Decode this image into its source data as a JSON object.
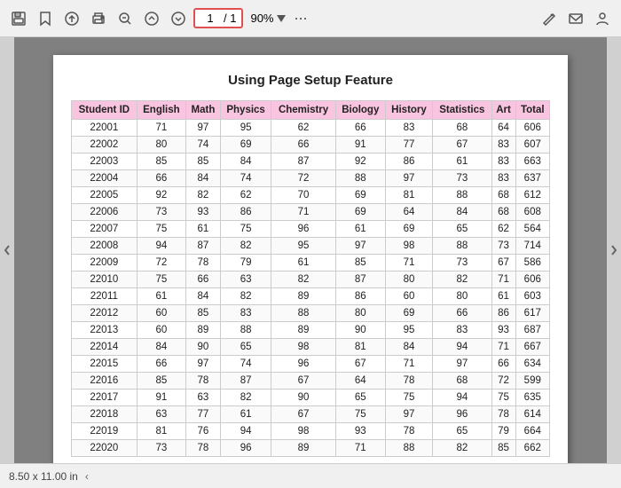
{
  "toolbar": {
    "page_current": "1",
    "page_total": "1",
    "zoom": "90%",
    "icons": [
      "save",
      "bookmark",
      "upload",
      "print",
      "zoom-out",
      "upload-arrow",
      "download-arrow"
    ],
    "more_label": "···"
  },
  "page": {
    "title": "Using Page Setup Feature",
    "columns": [
      "Student ID",
      "English",
      "Math",
      "Physics",
      "Chemistry",
      "Biology",
      "History",
      "Statistics",
      "Art",
      "Total"
    ],
    "rows": [
      [
        22001,
        71,
        97,
        95,
        62,
        66,
        83,
        68,
        64,
        606
      ],
      [
        22002,
        80,
        74,
        69,
        66,
        91,
        77,
        67,
        83,
        607
      ],
      [
        22003,
        85,
        85,
        84,
        87,
        92,
        86,
        61,
        83,
        663
      ],
      [
        22004,
        66,
        84,
        74,
        72,
        88,
        97,
        73,
        83,
        637
      ],
      [
        22005,
        92,
        82,
        62,
        70,
        69,
        81,
        88,
        68,
        612
      ],
      [
        22006,
        73,
        93,
        86,
        71,
        69,
        64,
        84,
        68,
        608
      ],
      [
        22007,
        75,
        61,
        75,
        96,
        61,
        69,
        65,
        62,
        564
      ],
      [
        22008,
        94,
        87,
        82,
        95,
        97,
        98,
        88,
        73,
        714
      ],
      [
        22009,
        72,
        78,
        79,
        61,
        85,
        71,
        73,
        67,
        586
      ],
      [
        22010,
        75,
        66,
        63,
        82,
        87,
        80,
        82,
        71,
        606
      ],
      [
        22011,
        61,
        84,
        82,
        89,
        86,
        60,
        80,
        61,
        603
      ],
      [
        22012,
        60,
        85,
        83,
        88,
        80,
        69,
        66,
        86,
        617
      ],
      [
        22013,
        60,
        89,
        88,
        89,
        90,
        95,
        83,
        93,
        687
      ],
      [
        22014,
        84,
        90,
        65,
        98,
        81,
        84,
        94,
        71,
        667
      ],
      [
        22015,
        66,
        97,
        74,
        96,
        67,
        71,
        97,
        66,
        634
      ],
      [
        22016,
        85,
        78,
        87,
        67,
        64,
        78,
        68,
        72,
        599
      ],
      [
        22017,
        91,
        63,
        82,
        90,
        65,
        75,
        94,
        75,
        635
      ],
      [
        22018,
        63,
        77,
        61,
        67,
        75,
        97,
        96,
        78,
        614
      ],
      [
        22019,
        81,
        76,
        94,
        98,
        93,
        78,
        65,
        79,
        664
      ],
      [
        22020,
        73,
        78,
        96,
        89,
        71,
        88,
        82,
        85,
        662
      ]
    ]
  },
  "statusbar": {
    "size": "8.50 x 11.00 in"
  }
}
